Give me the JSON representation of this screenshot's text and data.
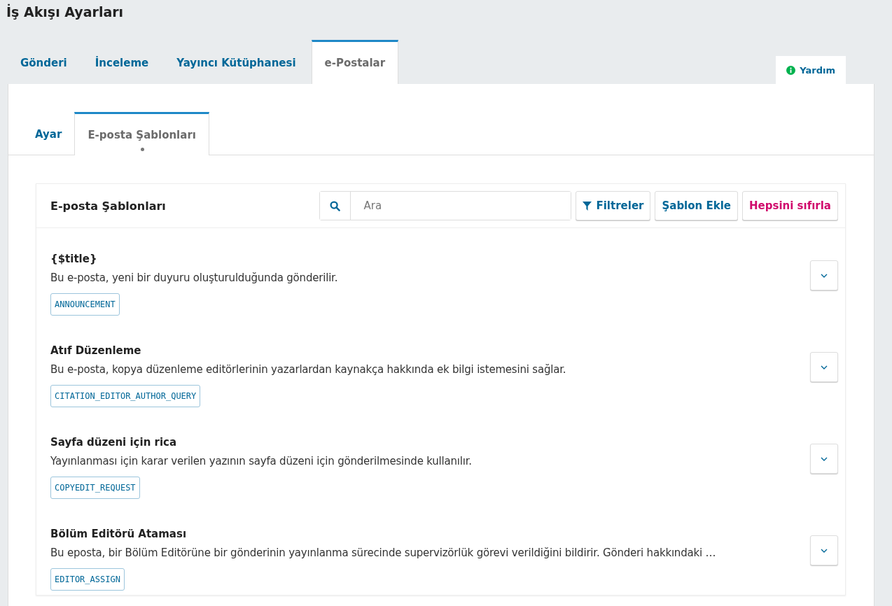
{
  "page_title": "İş Akışı Ayarları",
  "tabs": [
    {
      "label": "Gönderi",
      "selected": false
    },
    {
      "label": "İnceleme",
      "selected": false
    },
    {
      "label": "Yayıncı Kütüphanesi",
      "selected": false
    },
    {
      "label": "e-Postalar",
      "selected": true
    }
  ],
  "help": {
    "label": "Yardım"
  },
  "subtabs": [
    {
      "label": "Ayar",
      "selected": false,
      "dot": false
    },
    {
      "label": "E-posta Şablonları",
      "selected": true,
      "dot": true
    }
  ],
  "panel": {
    "title": "E-posta Şablonları",
    "search": {
      "placeholder": "Ara"
    },
    "buttons": [
      {
        "label": "Filtreler",
        "kind": "filter"
      },
      {
        "label": "Şablon Ekle",
        "kind": "default"
      },
      {
        "label": "Hepsini sıfırla",
        "kind": "danger"
      }
    ]
  },
  "templates": [
    {
      "title": "{$title}",
      "description": "Bu e-posta, yeni bir duyuru oluşturulduğunda gönderilir.",
      "key": "ANNOUNCEMENT",
      "expanded": false
    },
    {
      "title": "Atıf Düzenleme",
      "description": "Bu e-posta, kopya düzenleme editörlerinin yazarlardan kaynakça hakkında ek bilgi istemesini sağlar.",
      "key": "CITATION_EDITOR_AUTHOR_QUERY",
      "expanded": false
    },
    {
      "title": "Sayfa düzeni için rica",
      "description": "Yayınlanması için karar verilen yazının sayfa düzeni için gönderilmesinde kullanılır.",
      "key": "COPYEDIT_REQUEST",
      "expanded": false
    },
    {
      "title": "Bölüm Editörü Ataması",
      "description": "Bu eposta, bir Bölüm Editörüne bir gönderinin yayınlanma sürecinde supervizörlük görevi verildiğini bildirir. Gönderi hakkındaki …",
      "key": "EDITOR_ASSIGN",
      "expanded": false
    }
  ]
}
